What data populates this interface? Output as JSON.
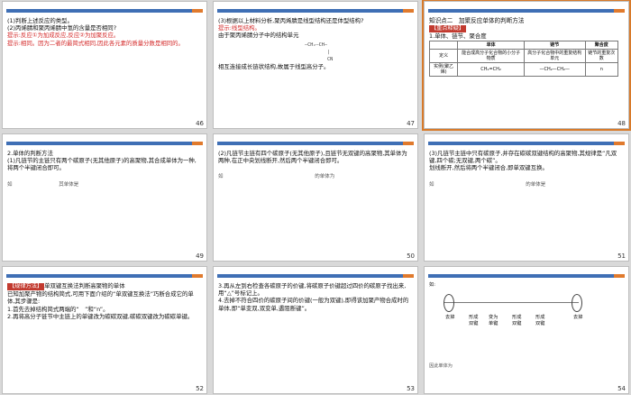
{
  "slides": [
    {
      "num": "46",
      "lines": [
        "(1)判断上述反应的类型。",
        "(2)丙烯腈和聚丙烯腈中氢的含量是否相同?",
        "提示:反应①为加成反应,反应②为加聚反应。",
        "提示:相同。因为二者的最简式相同,因此各元素的质量分数是相同的。"
      ]
    },
    {
      "num": "47",
      "lines": [
        "(3)根据以上材料分析,聚丙烯腈是线型结构还是体型结构?",
        "提示:线型结构。",
        "由于聚丙烯腈分子中的结构单元",
        "相互连接成长链状结构,故属于线型高分子。"
      ],
      "formula": "—CH₂—CH—\n        |\n        CN"
    },
    {
      "num": "48",
      "title": "知识点二　加聚反应单体的判断方法",
      "tag": "【重点释疑】",
      "sub": "1.单体、链节、聚合度",
      "table": {
        "headers": [
          "",
          "单体",
          "链节",
          "聚合度"
        ],
        "rows": [
          [
            "定义",
            "能合成高分子化合物的小分子物质",
            "高分子化合物中的重复结构单元",
            "链节的重复次数"
          ],
          [
            "实例(聚乙烯)",
            "CH₂=CH₂",
            "—CH₂—CH₂—",
            "n"
          ]
        ]
      }
    },
    {
      "num": "49",
      "lines": [
        "2.单体的判断方法",
        "(1)凡链节的主链只有两个碳原子(无其他原子)的高聚物,其合成单体为一种,将两个半键闭合即可。",
        "如",
        "其单体是"
      ]
    },
    {
      "num": "50",
      "lines": [
        "(2)凡链节主链有四个碳原子(无其他原子),且链节无双键的高聚物,其单体为两种,在正中央划线断开,然后两个半键闭合即可。",
        "如",
        "的单体为"
      ]
    },
    {
      "num": "51",
      "lines": [
        "(3)凡链节主链中只有碳原子,并存在碳碳双键结构的高聚物,其规律是“凡双键,四个碳;无双键,两个碳”。",
        "划线断开,然后将两个半键闭合,即单双键互换。",
        "如",
        "的单体是"
      ]
    },
    {
      "num": "52",
      "tag": "【规律方法】",
      "lines": [
        "单双键互换法判断高聚物的单体",
        "已知加聚产物的结构简式,可用下面介绍的“单双键互换法”巧断合成它的单体,其步骤是:",
        "1.首先去掉结构简式两端的“　”和“n”。",
        "2.再将高分子链节中主链上的单键改为碳碳双键,碳碳双键改为碳碳单键。"
      ]
    },
    {
      "num": "53",
      "lines": [
        "3.再从左到右检查各碳原子的价键,将碳原子价键超过四价的碳原子找出来,用“△”号标记上。",
        "4.去掉不符合四价的碳原子间的价键(一般为双键),即得该加聚产物合成时的单体,即“单变双,双变单,遇阻断键”。"
      ]
    },
    {
      "num": "54",
      "lines": [
        "如:",
        "去掉",
        "形成双键",
        "变为单键",
        "形成双键",
        "形成双键",
        "去掉",
        "因此单体为"
      ]
    }
  ]
}
